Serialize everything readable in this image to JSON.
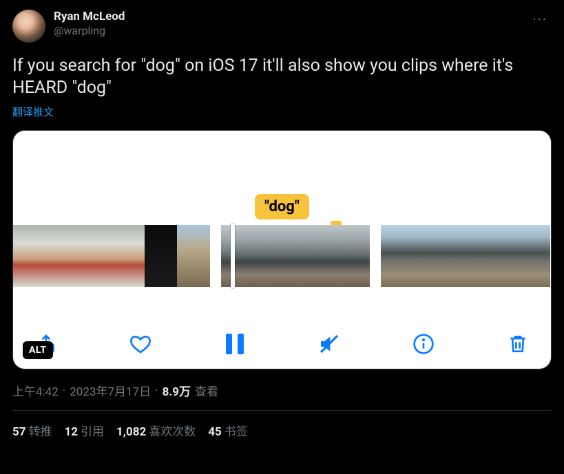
{
  "author": {
    "name": "Ryan McLeod",
    "handle": "@warpling"
  },
  "more_label": "···",
  "body": "If you search for \"dog\" on iOS 17 it'll also show you clips where it's HEARD \"dog\"",
  "translate": "翻译推文",
  "media": {
    "dog_label": "\"dog\"",
    "alt_badge": "ALT"
  },
  "meta": {
    "time": "上午4:42",
    "dot1": "·",
    "date": "2023年7月17日",
    "dot2": "·",
    "views_count": "8.9万",
    "views_label": "查看"
  },
  "stats": {
    "retweets_count": "57",
    "retweets_label": "转推",
    "quotes_count": "12",
    "quotes_label": "引用",
    "likes_count": "1,082",
    "likes_label": "喜欢次数",
    "bookmarks_count": "45",
    "bookmarks_label": "书签"
  }
}
